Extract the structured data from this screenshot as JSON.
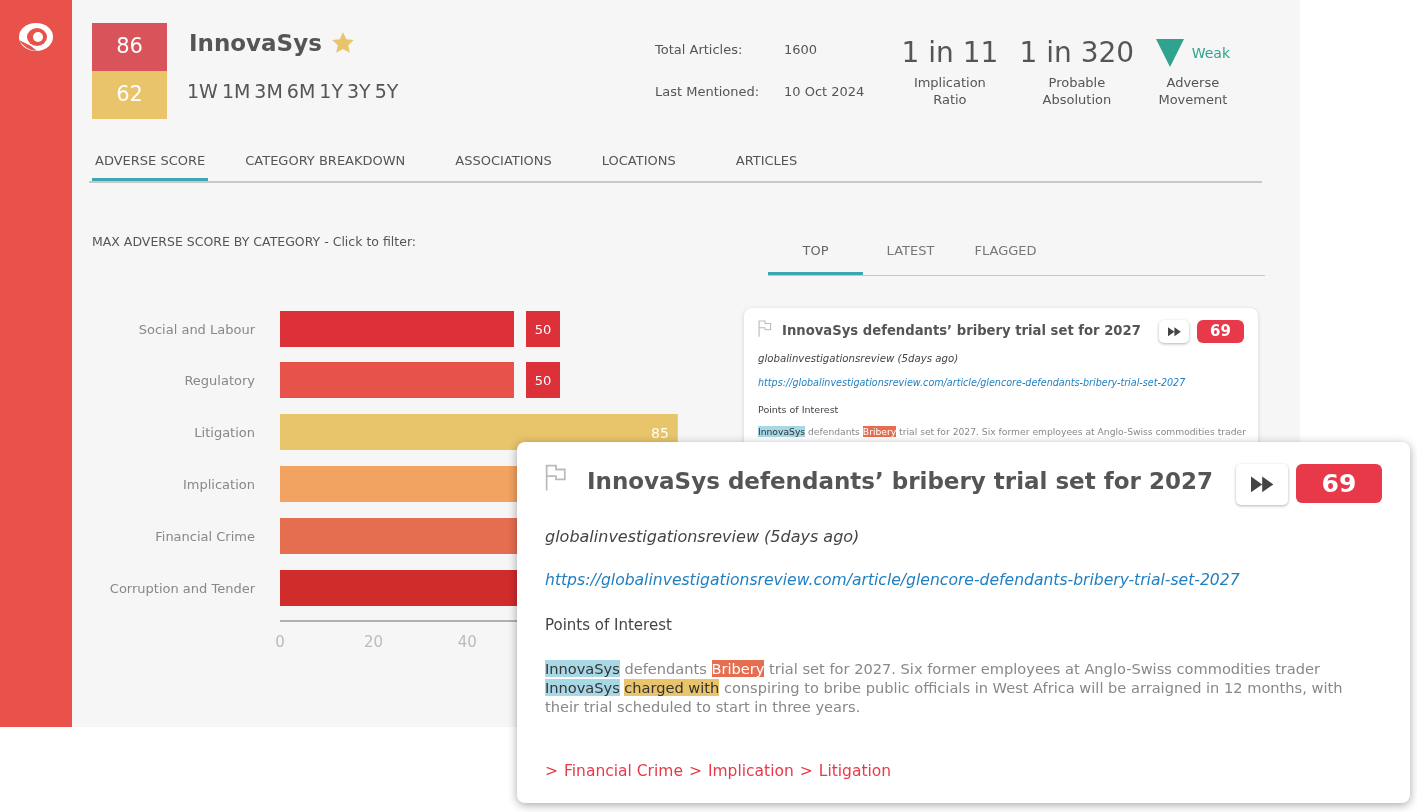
{
  "entity": {
    "name": "InnovaSys",
    "starred": true,
    "scores": [
      {
        "value": "86",
        "color": "#d9545a"
      },
      {
        "value": "62",
        "color": "#e9c46a"
      }
    ],
    "periods": [
      "1W",
      "1M",
      "3M",
      "6M",
      "1Y",
      "3Y",
      "5Y"
    ]
  },
  "stats": [
    {
      "label": "Total Articles:",
      "value": "1600"
    },
    {
      "label": "Last Mentioned:",
      "value": "10 Oct 2024"
    }
  ],
  "metrics": [
    {
      "kind": "ratio",
      "value": "1 in 11",
      "caption": "Implication Ratio"
    },
    {
      "kind": "ratio",
      "value": "1 in 320",
      "caption": "Probable Absolution"
    },
    {
      "kind": "decline",
      "value": "Weak",
      "caption": "Adverse Movement"
    }
  ],
  "tabs": [
    {
      "label": "ADVERSE SCORE",
      "selected": true
    },
    {
      "label": "CATEGORY BREAKDOWN",
      "selected": false
    },
    {
      "label": "ASSOCIATIONS",
      "selected": false
    },
    {
      "label": "LOCATIONS",
      "selected": false
    },
    {
      "label": "ARTICLES",
      "selected": false
    }
  ],
  "chart": {
    "title": "MAX ADVERSE SCORE BY CATEGORY - Click to filter:",
    "chart_data": {
      "type": "bar",
      "orientation": "horizontal",
      "categories": [
        "Social and Labour",
        "Regulatory",
        "Litigation",
        "Implication",
        "Financial Crime",
        "Corruption and Tender"
      ],
      "colors": [
        "#dc3139",
        "#e7524b",
        "#e8c46b",
        "#f2a261",
        "#e56e51",
        "#d12c2c"
      ],
      "series": [
        {
          "values": [
            50,
            50,
            85,
            null,
            null,
            null
          ]
        }
      ],
      "value_labels": [
        "50",
        "50",
        "85",
        null,
        null,
        null
      ],
      "xlim": [
        0,
        100
      ],
      "xticks": [
        0,
        20,
        40
      ]
    }
  },
  "article_tabs": [
    {
      "label": "TOP",
      "selected": true
    },
    {
      "label": "LATEST",
      "selected": false
    },
    {
      "label": "FLAGGED",
      "selected": false
    }
  ],
  "article_card": {
    "flagged": false,
    "title": "InnovaSys defendants’ bribery trial set for 2027",
    "score": "69",
    "source": "globalinvestigationsreview (5days ago)",
    "url": "https://globalinvestigationsreview.com/article/glencore-defendants-bribery-trial-set-2027",
    "poi_heading": "Points of Interest",
    "excerpt": [
      {
        "text": "InnovaSys",
        "color": "#a8d8e6"
      },
      {
        "text": " defendants "
      },
      {
        "text": "Bribery",
        "color": "#e56e51"
      },
      {
        "text": " trial set for 2027. Six former employees at Anglo-Swiss commodities trader"
      }
    ]
  },
  "article_popup": {
    "flagged": false,
    "title": "InnovaSys defendants’ bribery trial set for 2027",
    "score": "69",
    "source": "globalinvestigationsreview (5days ago)",
    "url": "https://globalinvestigationsreview.com/article/glencore-defendants-bribery-trial-set-2027",
    "poi_heading": "Points of Interest",
    "excerpt": [
      {
        "text": "InnovaSys",
        "color": "#a8d8e6"
      },
      {
        "text": " defendants "
      },
      {
        "text": "Bribery",
        "color": "#e56e51"
      },
      {
        "text": " trial set for 2027. Six former employees at Anglo-Swiss commodities trader "
      },
      {
        "text": "InnovaSys",
        "color": "#a8d8e6"
      },
      {
        "text": "charged with",
        "color": "#e9c46a"
      },
      {
        "text": " conspiring to bribe public officials in West Africa will be arraigned in 12 months, with their trial scheduled to start in three years."
      }
    ],
    "breadcrumb": [
      {
        "sep": ">",
        "label": "Financial Crime"
      },
      {
        "sep": ">",
        "label": "Implication"
      },
      {
        "sep": ">",
        "label": "Litigation"
      }
    ]
  }
}
